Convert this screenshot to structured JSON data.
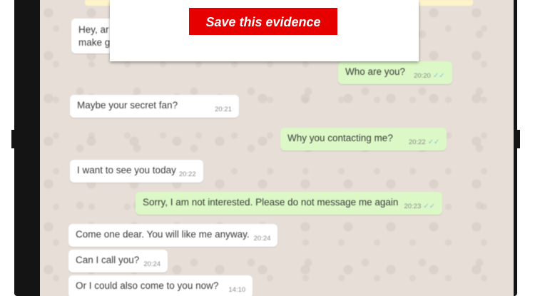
{
  "overlay": {
    "save_button_label": "Save this evidence"
  },
  "colors": {
    "save_button": "#e60000",
    "incoming_bubble": "#ffffff",
    "outgoing_bubble": "#dcf8c6",
    "read_tick": "#8cc1e4",
    "chat_background": "#e6ded7"
  },
  "messages": [
    {
      "direction": "in",
      "text": "Hey, ar",
      "text_line2": "make g",
      "time": ""
    },
    {
      "direction": "out",
      "text": "Who are you?",
      "time": "20:20",
      "ticks": "✓✓"
    },
    {
      "direction": "in",
      "text": "Maybe your secret fan?",
      "time": "20:21"
    },
    {
      "direction": "out",
      "text": "Why you contacting me?",
      "time": "20:22",
      "ticks": "✓✓"
    },
    {
      "direction": "in",
      "text": "I want to see you today",
      "time": "20:22"
    },
    {
      "direction": "out",
      "text": "Sorry, I am not interested. Please do not message me again",
      "time": "20:23",
      "ticks": "✓✓"
    },
    {
      "direction": "in",
      "text": "Come one dear. You will like me anyway.",
      "time": "20:24"
    },
    {
      "direction": "in",
      "text": "Can I call you?",
      "time": "20:24"
    },
    {
      "direction": "in",
      "text": "Or I could also come to you now?",
      "time": "14:10"
    }
  ]
}
